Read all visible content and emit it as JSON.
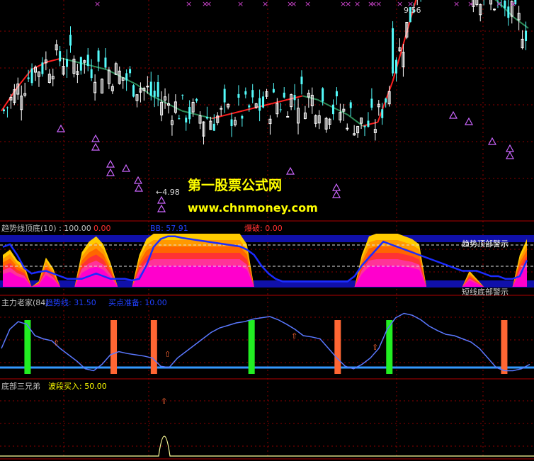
{
  "colors": {
    "background": "#000000",
    "grid": "#8b0000",
    "up_candle": "#54fcfc",
    "down_candle": "#ffffff",
    "ma_up": "#ff2020",
    "ma_down": "#2e8b57",
    "signal_triangle": "#cc66ff",
    "marker_x": "#cc44cc",
    "label_white": "#c0c0c0",
    "label_red": "#ff3030",
    "label_blue": "#2040ff",
    "label_yellow": "#ffff00",
    "trend_line": "#5a78ff",
    "base_line": "#3399ff",
    "bar_green": "#22ee22",
    "bar_orange": "#ff6633",
    "bottom_line": "#ffff99"
  },
  "watermark": {
    "title": "第一股票公式网",
    "url": "www.chnmoney.com"
  },
  "chart_data": [
    {
      "type": "candlestick",
      "panel": "main",
      "annotations": [
        {
          "text": "9.56",
          "at": "high"
        },
        {
          "text": "←4.98",
          "at": "low"
        }
      ],
      "ma_line": [
        7.2,
        7.8,
        8.3,
        8.5,
        8.6,
        8.5,
        8.4,
        8.3,
        8.1,
        7.9,
        7.6,
        7.4,
        7.2,
        7.1,
        7.0,
        7.1,
        7.2,
        7.3,
        7.4,
        7.5,
        7.6,
        7.5,
        7.3,
        7.1,
        6.8,
        6.9,
        8.0,
        9.4,
        10.8,
        11.4,
        11.1,
        10.7,
        10.4,
        10.1,
        9.7,
        9.4
      ]
    },
    {
      "type": "area",
      "panel": "indicator_1",
      "labels": [
        {
          "text": "趋势线顶底(10) : 100.00",
          "color": "label_white"
        },
        {
          "text": "0.00",
          "color": "label_red"
        },
        {
          "text": "BB: 57.91",
          "color": "label_blue"
        },
        {
          "text": "爆破: 0.00",
          "color": "label_red"
        }
      ],
      "signal_labels": [
        "趋势顶部警示",
        "短线底部警示"
      ],
      "ylim": [
        0,
        100
      ],
      "bands": [
        [
          0,
          60
        ],
        [
          0,
          70
        ],
        [
          0,
          50
        ],
        [
          0,
          40
        ],
        [
          0,
          0
        ],
        [
          0,
          10
        ],
        [
          0,
          55
        ],
        [
          0,
          35
        ],
        [
          0,
          0
        ],
        [
          0,
          0
        ],
        [
          0,
          0
        ],
        [
          0,
          65
        ],
        [
          0,
          85
        ],
        [
          0,
          95
        ],
        [
          0,
          80
        ],
        [
          0,
          45
        ],
        [
          0,
          0
        ],
        [
          0,
          0
        ],
        [
          0,
          0
        ],
        [
          0,
          60
        ],
        [
          0,
          90
        ],
        [
          0,
          100
        ],
        [
          0,
          100
        ],
        [
          0,
          100
        ],
        [
          0,
          100
        ],
        [
          0,
          100
        ],
        [
          0,
          100
        ],
        [
          0,
          100
        ],
        [
          0,
          100
        ],
        [
          0,
          100
        ],
        [
          0,
          100
        ],
        [
          0,
          100
        ],
        [
          0,
          100
        ],
        [
          0,
          100
        ],
        [
          0,
          80
        ],
        [
          0,
          0
        ],
        [
          0,
          0
        ],
        [
          0,
          0
        ],
        [
          0,
          0
        ],
        [
          0,
          0
        ],
        [
          0,
          0
        ],
        [
          0,
          0
        ],
        [
          0,
          0
        ],
        [
          0,
          0
        ],
        [
          0,
          0
        ],
        [
          0,
          0
        ],
        [
          0,
          0
        ],
        [
          0,
          0
        ],
        [
          0,
          0
        ],
        [
          0,
          0
        ],
        [
          0,
          60
        ],
        [
          0,
          95
        ],
        [
          0,
          100
        ],
        [
          0,
          100
        ],
        [
          0,
          100
        ],
        [
          0,
          100
        ],
        [
          0,
          95
        ],
        [
          0,
          90
        ],
        [
          0,
          80
        ],
        [
          0,
          0
        ],
        [
          0,
          0
        ],
        [
          0,
          0
        ],
        [
          0,
          0
        ],
        [
          0,
          0
        ],
        [
          0,
          0
        ],
        [
          0,
          30
        ],
        [
          0,
          15
        ],
        [
          0,
          0
        ],
        [
          0,
          0
        ],
        [
          0,
          0
        ],
        [
          0,
          0
        ],
        [
          0,
          0
        ],
        [
          0,
          60
        ],
        [
          0,
          90
        ]
      ],
      "bb_line": [
        75,
        80,
        60,
        35,
        25,
        28,
        30,
        25,
        20,
        15,
        15,
        15,
        20,
        25,
        20,
        15,
        15,
        15,
        12,
        15,
        40,
        75,
        90,
        95,
        95,
        92,
        90,
        88,
        86,
        84,
        82,
        80,
        78,
        76,
        70,
        60,
        40,
        25,
        15,
        10,
        10,
        10,
        10,
        10,
        10,
        10,
        10,
        10,
        10,
        20,
        40,
        55,
        70,
        85,
        80,
        75,
        70,
        65,
        60,
        55,
        50,
        45,
        40,
        35,
        30,
        30,
        30,
        25,
        20,
        20,
        15,
        15,
        20,
        50
      ]
    },
    {
      "type": "line",
      "panel": "indicator_2",
      "labels": [
        {
          "text": "主力老家(84)",
          "color": "label_white"
        },
        {
          "text": "趋势线: 31.50",
          "color": "label_blue"
        },
        {
          "text": "买点准备: 10.00",
          "color": "label_blue"
        }
      ],
      "ylim": [
        0,
        100
      ],
      "base_value": 10,
      "trend": [
        40,
        70,
        82,
        78,
        60,
        55,
        52,
        40,
        30,
        20,
        8,
        5,
        15,
        30,
        35,
        32,
        30,
        28,
        25,
        12,
        10,
        25,
        35,
        45,
        55,
        65,
        72,
        76,
        80,
        82,
        86,
        88,
        90,
        85,
        78,
        70,
        60,
        58,
        55,
        40,
        25,
        12,
        8,
        15,
        25,
        40,
        70,
        88,
        95,
        92,
        85,
        75,
        68,
        62,
        60,
        55,
        50,
        40,
        25,
        10,
        5,
        5,
        8,
        15
      ],
      "bars": [
        {
          "index": 4,
          "color": "bar_green"
        },
        {
          "index": 19,
          "color": "bar_orange"
        },
        {
          "index": 26,
          "color": "bar_orange"
        },
        {
          "index": 43,
          "color": "bar_green"
        },
        {
          "index": 58,
          "color": "bar_orange"
        },
        {
          "index": 67,
          "color": "bar_green"
        },
        {
          "index": 87,
          "color": "bar_orange"
        }
      ]
    },
    {
      "type": "line",
      "panel": "indicator_3",
      "labels": [
        {
          "text": "底部三兄弟",
          "color": "label_white"
        },
        {
          "text": "波段买入: 50.00",
          "color": "label_yellow"
        }
      ],
      "ylim": [
        0,
        100
      ],
      "spike_index": 27,
      "spike_value": 100
    }
  ]
}
